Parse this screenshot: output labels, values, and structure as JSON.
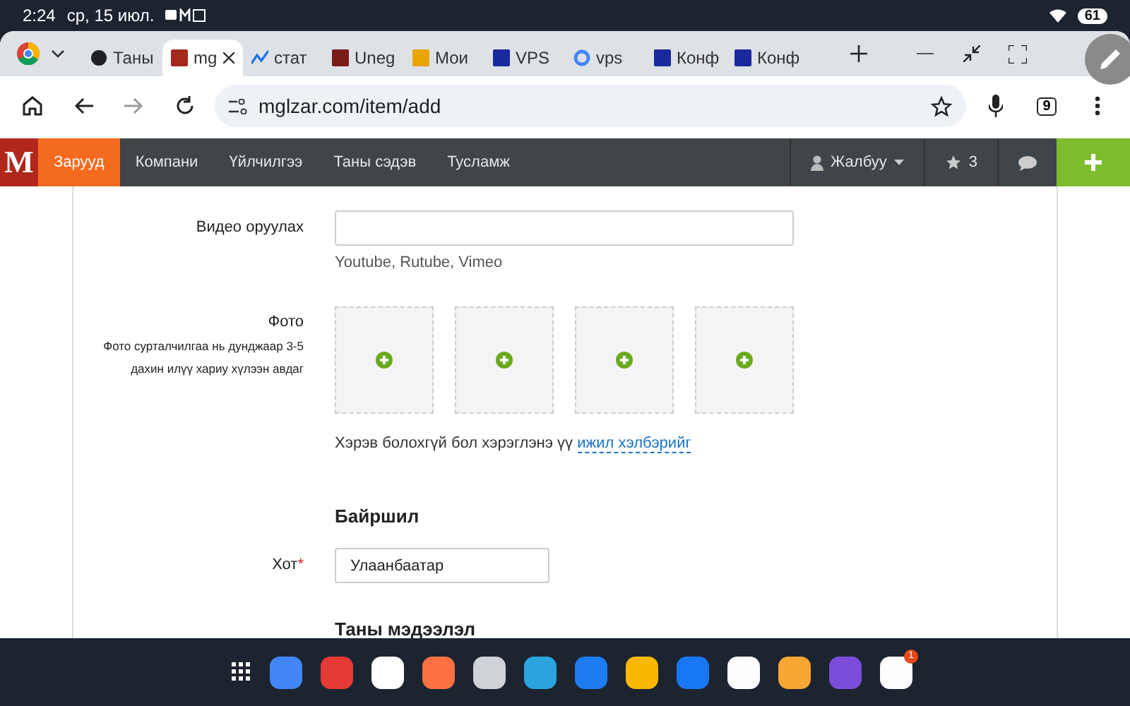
{
  "status_bar": {
    "time": "2:24",
    "date": "ср, 15 июл.",
    "battery": "61"
  },
  "browser": {
    "tabs": [
      {
        "label": "Таны",
        "selected": false,
        "kind": "globe",
        "color": "#202124"
      },
      {
        "label": "mg",
        "selected": true,
        "kind": "square",
        "color": "#a4281e"
      },
      {
        "label": "стат",
        "selected": false,
        "kind": "chart",
        "color": "#1a73e8"
      },
      {
        "label": "Uneg",
        "selected": false,
        "kind": "square",
        "color": "#7b1b17"
      },
      {
        "label": "Мои",
        "selected": false,
        "kind": "square",
        "color": "#e8a500"
      },
      {
        "label": "VPS",
        "selected": false,
        "kind": "square",
        "color": "#1a2a9c"
      },
      {
        "label": "vps",
        "selected": false,
        "kind": "google",
        "color": "#4285f4"
      },
      {
        "label": "Конф",
        "selected": false,
        "kind": "square",
        "color": "#1a2a9c"
      },
      {
        "label": "Конф",
        "selected": false,
        "kind": "square",
        "color": "#1a2a9c"
      }
    ],
    "url": "mglzar.com/item/add",
    "tab_count": "9"
  },
  "site_nav": {
    "logo": "M",
    "items": [
      {
        "label": "Зарууд",
        "selected": true
      },
      {
        "label": "Компани",
        "selected": false
      },
      {
        "label": "Үйлчилгээ",
        "selected": false
      },
      {
        "label": "Таны сэдэв",
        "selected": false
      },
      {
        "label": "Тусламж",
        "selected": false
      }
    ],
    "user": "Жалбуу",
    "favorites": "3"
  },
  "form": {
    "video": {
      "label": "Видео оруулах",
      "hint": "Youtube, Rutube, Vimeo"
    },
    "photo": {
      "label": "Фото",
      "note": "Фото сурталчилгаа нь дунджаар 3-5 дахин илүү хариу хүлээн авдаг",
      "slots": [
        {
          "kind": "add"
        },
        {
          "kind": "add"
        },
        {
          "kind": "add"
        },
        {
          "kind": "add"
        }
      ],
      "fallback": "Хэрэв болохгүй бол хэрэглэнэ үү",
      "fallback_link": "ижил хэлбэрийг"
    },
    "location_heading": "Байршил",
    "city": {
      "label": "Хот",
      "required_mark": "*",
      "value": "Улаанбаатар"
    },
    "info_heading": "Таны мэдээлэл"
  },
  "dock": {
    "apps": [
      {
        "color": "#4285f4"
      },
      {
        "color": "#e53935"
      },
      {
        "color": "#ffffff"
      },
      {
        "color": "#ff7043"
      },
      {
        "color": "#cfd3d8"
      },
      {
        "color": "#2aa3df"
      },
      {
        "color": "#1e7cf2"
      },
      {
        "color": "#f9b800"
      },
      {
        "color": "#1877f2"
      },
      {
        "color": "#fefefe"
      },
      {
        "color": "#f7a533"
      },
      {
        "color": "#7c4ddb"
      },
      {
        "color": "#fdfdfd",
        "badge": "1"
      }
    ]
  }
}
